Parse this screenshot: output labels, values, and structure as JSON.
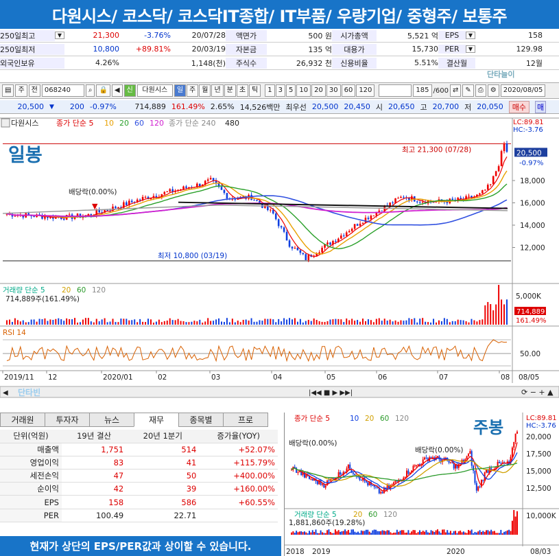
{
  "header": {
    "title": "다원시스/ 코스닥/ 코스닥IT종합/ IT부품/ 우량기업/ 중형주/ 보통주"
  },
  "info": {
    "row1": {
      "label": "250일최고",
      "price": "21,300",
      "pct": "-3.76%",
      "date": "20/07/28",
      "k1": "액면가",
      "v1": "500 원",
      "k2": "시가총액",
      "v2": "5,521 억",
      "k3": "EPS",
      "v3": "158"
    },
    "row2": {
      "label": "250일최저",
      "price": "10,800",
      "pct": "+89.81%",
      "date": "20/03/19",
      "k1": "자본금",
      "v1": "135 억",
      "k2": "대용가",
      "v2": "15,730",
      "k3": "PER",
      "v3": "129.98"
    },
    "row3": {
      "label": "외국인보유",
      "price": "4.26%",
      "pct": "1,148(천)",
      "k1": "주식수",
      "v1": "26,932 천",
      "k2": "신용비율",
      "v2": "5.51%",
      "k3": "결산월",
      "v3": "12월"
    },
    "brand": "단타늘이"
  },
  "toolbar": {
    "type": "주",
    "sel": "전",
    "code": "068240",
    "name": "다원시스",
    "periods": [
      "일",
      "주",
      "월",
      "년",
      "분",
      "초",
      "틱"
    ],
    "intervals": [
      "1",
      "3",
      "5",
      "10",
      "20",
      "30",
      "60",
      "120"
    ],
    "count": "185",
    "total": "/600",
    "date": "2020/08/05"
  },
  "quote": {
    "price": "20,500",
    "change": "200",
    "pct": "-0.97%",
    "volume": "714,889",
    "vol_pct": "161.49%",
    "turnover": "2.65%",
    "amount": "14,526백만",
    "best_label": "최우선",
    "ask": "20,500",
    "bid": "20,450",
    "open_label": "시",
    "open": "20,650",
    "high_label": "고",
    "high": "20,700",
    "low_label": "저",
    "low": "20,050",
    "buy": "매수",
    "sell": "매"
  },
  "chart": {
    "legend_name": "다원시스",
    "legend_ma": "종가 단순 5",
    "ma_periods": [
      "10",
      "20",
      "60",
      "120"
    ],
    "legend_ma2": "종가 단순 240",
    "legend_480": "480",
    "lc": "LC:89.81",
    "hc": "HC:-3.76",
    "watermark": "일봉",
    "max_label": "최고 21,300 (07/28)",
    "min_label": "최저 10,800 (03/19)",
    "div_label": "배당락(0.00%)",
    "cur_price": "20,500",
    "cur_pct": "-0.97%",
    "yticks": [
      "18,000",
      "16,000",
      "14,000",
      "12,000"
    ],
    "vol_legend": "거래량 단순 5",
    "vol_periods": [
      "20",
      "60",
      "120"
    ],
    "vol_value": "714,889주(161.49%)",
    "vol_tick": "5,000K",
    "vol_cur": "714,889",
    "vol_cur_pct": "161.49%",
    "rsi_legend": "RSI 14",
    "rsi_tick": "50.00",
    "xticks": [
      "2019/11",
      "12",
      "2020/01",
      "02",
      "03",
      "04",
      "05",
      "06",
      "07",
      "08"
    ],
    "xend": "08/05",
    "nav_logo": "단타빈"
  },
  "bottom_tabs": [
    "거래원",
    "투자자",
    "뉴스",
    "재무",
    "종목별",
    "프로"
  ],
  "fin": {
    "headers": [
      "단위(억원)",
      "19년 결산",
      "20년 1분기",
      "증가율(YOY)"
    ],
    "rows": [
      [
        "매출액",
        "1,751",
        "514",
        "+52.07%"
      ],
      [
        "영업이익",
        "83",
        "41",
        "+115.79%"
      ],
      [
        "세전손익",
        "47",
        "50",
        "+400.00%"
      ],
      [
        "순이익",
        "42",
        "39",
        "+160.00%"
      ],
      [
        "EPS",
        "158",
        "586",
        "+60.55%"
      ],
      [
        "PER",
        "100.49",
        "22.71",
        ""
      ]
    ]
  },
  "footer": {
    "text": "현재가 상단의 EPS/PER값과 상이할 수 있습니다."
  },
  "weekly": {
    "legend": "종가 단순 5",
    "ma": [
      "10",
      "20",
      "60",
      "120"
    ],
    "watermark": "주봉",
    "lc": "LC:89.81",
    "hc": "HC:-3.76",
    "div1": "배당락(0.00%)",
    "div2": "배당락(0.00%)",
    "yticks": [
      "20,000",
      "17,500",
      "15,000",
      "12,500"
    ],
    "vol_legend": "거래량 단순 5",
    "vol_ma": [
      "20",
      "60",
      "120"
    ],
    "vol_value": "1,881,860주(19.28%)",
    "vol_tick": "10,000K",
    "xticks": [
      "2018",
      "2019",
      "2020",
      "08/03"
    ]
  }
}
